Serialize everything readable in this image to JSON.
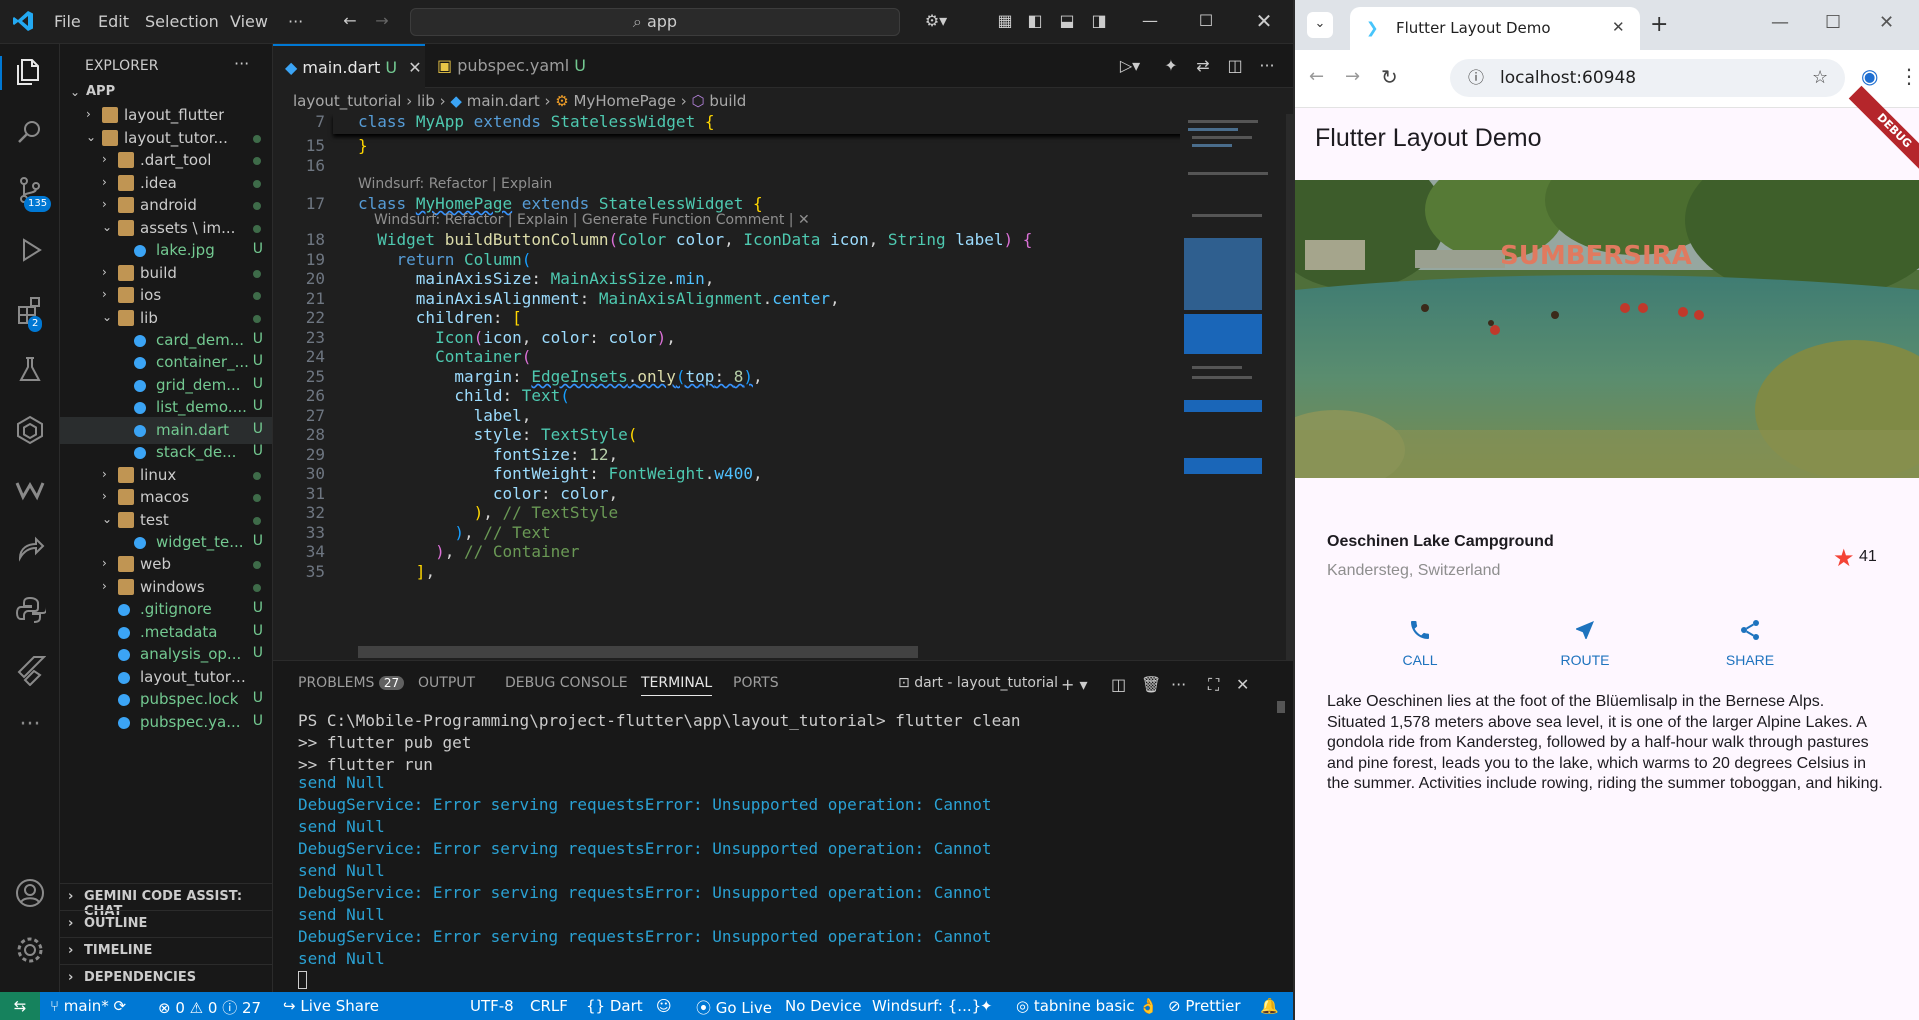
{
  "vscode": {
    "menu": [
      "File",
      "Edit",
      "Selection",
      "View",
      "···"
    ],
    "search_text": "app",
    "explorer_title": "EXPLORER",
    "tree": [
      {
        "label": "APP",
        "kind": "root"
      },
      {
        "label": "layout_flutter",
        "kind": "folder"
      },
      {
        "label": "layout_tutor...",
        "kind": "folder-open"
      },
      {
        "label": ".dart_tool",
        "kind": "folder"
      },
      {
        "label": ".idea",
        "kind": "folder"
      },
      {
        "label": "android",
        "kind": "folder"
      },
      {
        "label": "assets \\ im...",
        "kind": "folder-open"
      },
      {
        "label": "lake.jpg",
        "kind": "file",
        "status": "U"
      },
      {
        "label": "build",
        "kind": "folder"
      },
      {
        "label": "ios",
        "kind": "folder"
      },
      {
        "label": "lib",
        "kind": "folder-open"
      },
      {
        "label": "card_dem...",
        "kind": "file",
        "status": "U"
      },
      {
        "label": "container_...",
        "kind": "file",
        "status": "U"
      },
      {
        "label": "grid_dem...",
        "kind": "file",
        "status": "U"
      },
      {
        "label": "list_demo....",
        "kind": "file",
        "status": "U"
      },
      {
        "label": "main.dart",
        "kind": "file",
        "status": "U"
      },
      {
        "label": "stack_de...",
        "kind": "file",
        "status": "U"
      },
      {
        "label": "linux",
        "kind": "folder"
      },
      {
        "label": "macos",
        "kind": "folder"
      },
      {
        "label": "test",
        "kind": "folder-open"
      },
      {
        "label": "widget_te...",
        "kind": "file",
        "status": "U"
      },
      {
        "label": "web",
        "kind": "folder"
      },
      {
        "label": "windows",
        "kind": "folder"
      },
      {
        "label": ".gitignore",
        "kind": "file",
        "status": "U"
      },
      {
        "label": ".metadata",
        "kind": "file",
        "status": "U"
      },
      {
        "label": "analysis_op...",
        "kind": "file",
        "status": "U"
      },
      {
        "label": "layout_tutorial.iml",
        "kind": "file"
      },
      {
        "label": "pubspec.lock",
        "kind": "file",
        "status": "U"
      },
      {
        "label": "pubspec.ya...",
        "kind": "file",
        "status": "U"
      }
    ],
    "sections": [
      "GEMINI CODE ASSIST: CHAT",
      "OUTLINE",
      "TIMELINE",
      "DEPENDENCIES"
    ],
    "tabs": [
      {
        "label": "main.dart",
        "status": "U"
      },
      {
        "label": "pubspec.yaml",
        "status": "U"
      }
    ],
    "breadcrumb": [
      "layout_tutorial",
      "lib",
      "main.dart",
      "MyHomePage",
      "build"
    ],
    "badges": {
      "scm": "135",
      "extensions": "2"
    },
    "code_lines": [
      {
        "n": "7",
        "text": "class MyApp extends StatelessWidget {"
      },
      {
        "n": "15",
        "text": "}"
      },
      {
        "n": "16",
        "text": ""
      },
      {
        "n": "17",
        "text": "class MyHomePage extends StatelessWidget {"
      },
      {
        "n": "18",
        "text": "  Widget buildButtonColumn(Color color, IconData icon, String label) {"
      },
      {
        "n": "19",
        "text": "    return Column("
      },
      {
        "n": "20",
        "text": "      mainAxisSize: MainAxisSize.min,"
      },
      {
        "n": "21",
        "text": "      mainAxisAlignment: MainAxisAlignment.center,"
      },
      {
        "n": "22",
        "text": "      children: ["
      },
      {
        "n": "23",
        "text": "        Icon(icon, color: color),"
      },
      {
        "n": "24",
        "text": "        Container("
      },
      {
        "n": "25",
        "text": "          margin: EdgeInsets.only(top: 8),"
      },
      {
        "n": "26",
        "text": "          child: Text("
      },
      {
        "n": "27",
        "text": "            label,"
      },
      {
        "n": "28",
        "text": "            style: TextStyle("
      },
      {
        "n": "29",
        "text": "              fontSize: 12,"
      },
      {
        "n": "30",
        "text": "              fontWeight: FontWeight.w400,"
      },
      {
        "n": "31",
        "text": "              color: color,"
      },
      {
        "n": "32",
        "text": "            ), // TextStyle"
      },
      {
        "n": "33",
        "text": "          ), // Text"
      },
      {
        "n": "34",
        "text": "        ), // Container"
      },
      {
        "n": "35",
        "text": "      ],"
      }
    ],
    "hint1": "Windsurf: Refactor | Explain",
    "hint2": "Windsurf: Refactor | Explain | Generate Function Comment | ✕",
    "panel_tabs": [
      "PROBLEMS",
      "OUTPUT",
      "DEBUG CONSOLE",
      "TERMINAL",
      "PORTS"
    ],
    "problems_count": "27",
    "terminal_name": "dart - layout_tutorial",
    "terminal_lines": [
      "PS C:\\Mobile-Programming\\project-flutter\\app\\layout_tutorial> flutter clean",
      ">> flutter pub get",
      ">> flutter run",
      "send Null",
      "DebugService: Error serving requestsError: Unsupported operation: Cannot",
      "send Null",
      "DebugService: Error serving requestsError: Unsupported operation: Cannot",
      "send Null",
      "DebugService: Error serving requestsError: Unsupported operation: Cannot",
      "send Null",
      "DebugService: Error serving requestsError: Unsupported operation: Cannot",
      "send Null"
    ],
    "status": {
      "branch": "main*",
      "errors": "0",
      "warnings": "0",
      "info": "27",
      "live_share": "Live Share",
      "encoding": "UTF-8",
      "eol": "CRLF",
      "language": "Dart",
      "go_live": "Go Live",
      "device": "No Device",
      "windsurf": "Windsurf: {...}",
      "tabnine": "tabnine basic 👌",
      "prettier": "Prettier"
    }
  },
  "chrome": {
    "tab_title": "Flutter Layout Demo",
    "url": "localhost:60948"
  },
  "flutter": {
    "app_title": "Flutter Layout Demo",
    "debug_banner": "DEBUG",
    "title": "Oeschinen Lake Campground",
    "subtitle": "Kandersteg, Switzerland",
    "stars": "41",
    "buttons": [
      "CALL",
      "ROUTE",
      "SHARE"
    ],
    "photo_sign": "SUMBERSIRA",
    "description": "Lake Oeschinen lies at the foot of the Blüemlisalp in the Bernese Alps. Situated 1,578 meters above sea level, it is one of the larger Alpine Lakes. A gondola ride from Kandersteg, followed by a half-hour walk through pastures and pine forest, leads you to the lake, which warms to 20 degrees Celsius in the summer. Activities include rowing, riding the summer toboggan, and hiking.",
    "accent_color": "#1e73be",
    "star_color": "#f44336"
  }
}
